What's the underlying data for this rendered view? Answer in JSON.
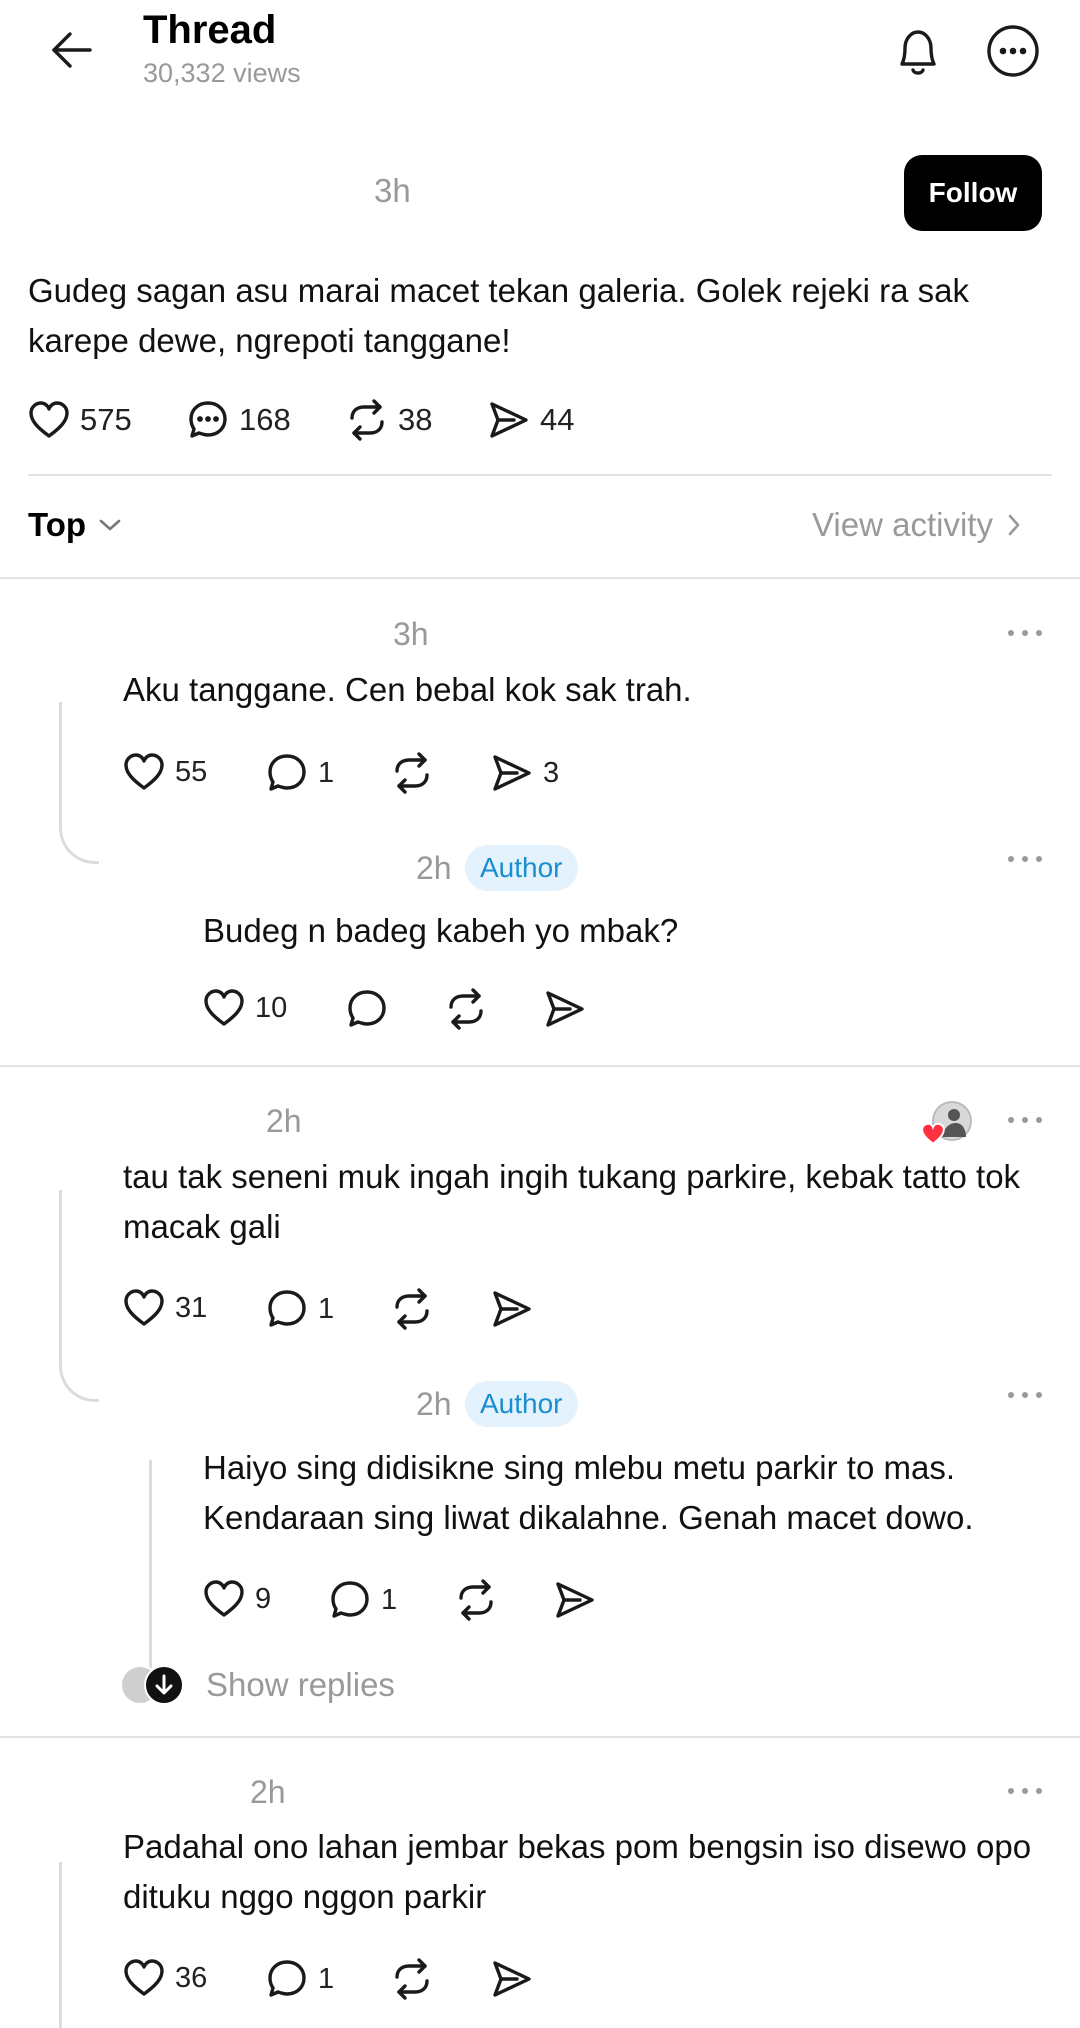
{
  "header": {
    "title": "Thread",
    "views": "30,332 views"
  },
  "post": {
    "time": "3h",
    "follow_label": "Follow",
    "text": "Gudeg sagan asu marai macet tekan galeria. Golek rejeki ra sak karepe dewe, ngrepoti tanggane!",
    "likes": "575",
    "comments": "168",
    "reposts": "38",
    "shares": "44"
  },
  "sort": {
    "label": "Top",
    "view_activity": "View activity"
  },
  "replies": [
    {
      "time": "3h",
      "text": "Aku tanggane. Cen bebal kok sak trah.",
      "likes": "55",
      "comments": "1",
      "shares": "3",
      "sub": {
        "time": "2h",
        "badge": "Author",
        "text": "Budeg n badeg kabeh yo mbak?",
        "likes": "10"
      }
    },
    {
      "time": "2h",
      "text": "tau tak seneni muk ingah ingih tukang parkire, kebak tatto tok macak gali",
      "likes": "31",
      "comments": "1",
      "sub": {
        "time": "2h",
        "badge": "Author",
        "text": "Haiyo sing didisikne sing mlebu metu parkir to mas. Kendaraan sing liwat dikalahne. Genah macet dowo.",
        "likes": "9",
        "comments": "1"
      },
      "show_replies": "Show replies"
    },
    {
      "time": "2h",
      "text": "Padahal ono lahan jembar bekas pom bengsin iso disewo opo dituku nggo nggon parkir",
      "likes": "36",
      "comments": "1"
    }
  ],
  "icons": [
    "back-arrow-icon",
    "bell-icon",
    "more-circle-icon",
    "heart-icon",
    "comment-icon",
    "repost-icon",
    "share-icon",
    "chevron-down-icon",
    "chevron-right-icon",
    "more-dots-icon"
  ],
  "colors": {
    "follow_bg": "#000000",
    "author_badge_bg": "#e3f2fc",
    "author_badge_text": "#1a8fcf",
    "like_indicator": "#ff3040"
  }
}
